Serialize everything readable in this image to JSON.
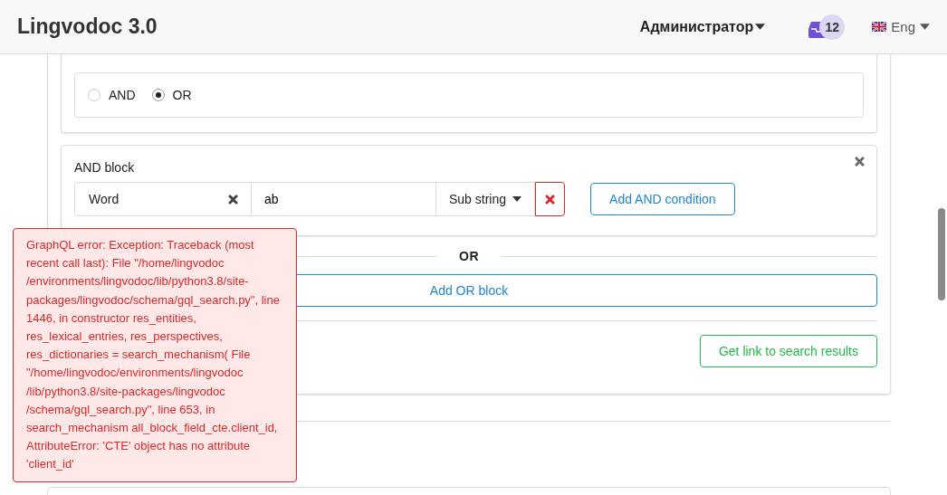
{
  "header": {
    "logo": "Lingvodoc 3.0",
    "user_menu": "Администратор",
    "notifications_count": "12",
    "language": "Eng"
  },
  "mode": {
    "options": [
      {
        "label": "AND",
        "selected": false
      },
      {
        "label": "OR",
        "selected": true
      }
    ]
  },
  "and_blocks": [
    {
      "title": "AND block",
      "conditions": [
        {
          "field": "Word",
          "value": "ab",
          "match_type": "Sub string"
        }
      ],
      "add_button": "Add AND condition"
    }
  ],
  "or_separator": "OR",
  "add_or_button": "Add OR block",
  "link_button": "Get link to search results",
  "error_toast": "GraphQL error: Exception: Traceback (most recent call last): File \"/home/lingvodoc /environments/lingvodoc/lib/python3.8/site-packages/lingvodoc/schema/gql_search.py\", line 1446, in constructor res_entities, res_lexical_entries, res_perspectives, res_dictionaries = search_mechanism( File \"/home/lingvodoc/environments/lingvodoc /lib/python3.8/site-packages/lingvodoc /schema/gql_search.py\", line 653, in search_mechanism all_block_field_cte.client_id, AttributeError: 'CTE' object has no attribute 'client_id'"
}
